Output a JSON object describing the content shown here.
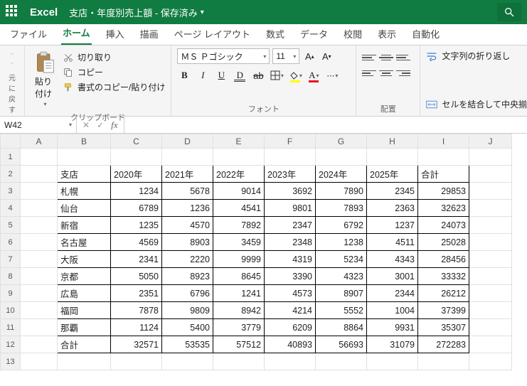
{
  "app": {
    "name": "Excel",
    "doc": "支店・年度別売上額 - 保存済み"
  },
  "tabs": [
    "ファイル",
    "ホーム",
    "挿入",
    "描画",
    "ページ レイアウト",
    "数式",
    "データ",
    "校閲",
    "表示",
    "自動化"
  ],
  "active_tab": 1,
  "ribbon": {
    "undo_label": "元に戻す",
    "paste": "貼り付け",
    "cut": "切り取り",
    "copy": "コピー",
    "format_painter": "書式のコピー/貼り付け",
    "clipboard_label": "クリップボード",
    "font_name": "ＭＳ Ｐゴシック",
    "font_size": "11",
    "font_label": "フォント",
    "align_label": "配置",
    "wrap": "文字列の折り返し",
    "merge": "セルを結合して中央揃え"
  },
  "namebox": "W42",
  "columns": [
    "A",
    "B",
    "C",
    "D",
    "E",
    "F",
    "G",
    "H",
    "I",
    "J"
  ],
  "chart_data": {
    "type": "table",
    "corner": "支店",
    "col_headers": [
      "2020年",
      "2021年",
      "2022年",
      "2023年",
      "2024年",
      "2025年",
      "合計"
    ],
    "row_headers": [
      "札幌",
      "仙台",
      "新宿",
      "名古屋",
      "大阪",
      "京都",
      "広島",
      "福岡",
      "那覇",
      "合計"
    ],
    "values": [
      [
        1234,
        5678,
        9014,
        3692,
        7890,
        2345,
        29853
      ],
      [
        6789,
        1236,
        4541,
        9801,
        7893,
        2363,
        32623
      ],
      [
        1235,
        4570,
        7892,
        2347,
        6792,
        1237,
        24073
      ],
      [
        4569,
        8903,
        3459,
        2348,
        1238,
        4511,
        25028
      ],
      [
        2341,
        2220,
        9999,
        4319,
        5234,
        4343,
        28456
      ],
      [
        5050,
        8923,
        8645,
        3390,
        4323,
        3001,
        33332
      ],
      [
        2351,
        6796,
        1241,
        4573,
        8907,
        2344,
        26212
      ],
      [
        7878,
        9809,
        8942,
        4214,
        5552,
        1004,
        37399
      ],
      [
        1124,
        5400,
        3779,
        6209,
        8864,
        9931,
        35307
      ],
      [
        32571,
        53535,
        57512,
        40893,
        56693,
        31079,
        272283
      ]
    ]
  }
}
